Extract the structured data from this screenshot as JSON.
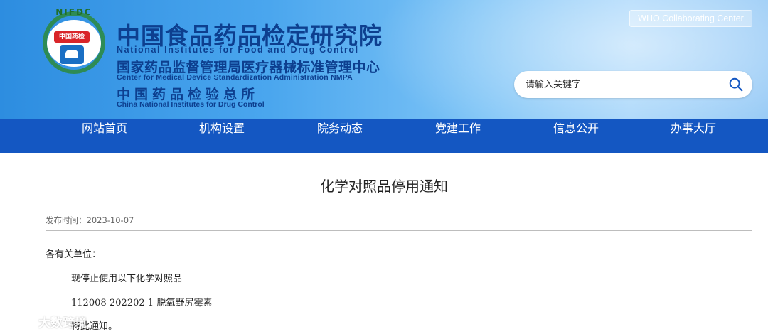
{
  "header": {
    "logo_ring_text": "NIFDC",
    "logo_seal_text": "中国药检",
    "title_cn": "中国食品药品检定研究院",
    "title_en": "National Institutes for Food and Drug Control",
    "sub1_cn": "国家药品监督管理局医疗器械标准管理中心",
    "sub1_en": "Center for Medical Device Standardization Administration NMPA",
    "sub2_cn": "中国药品检验总所",
    "sub2_en": "China National Institutes for Drug Control",
    "who_badge": "WHO Collaborating Center",
    "search": {
      "placeholder": "请输入关键字",
      "value": ""
    }
  },
  "nav": {
    "items": [
      "网站首页",
      "机构设置",
      "院务动态",
      "党建工作",
      "信息公开",
      "办事大厅"
    ]
  },
  "article": {
    "title": "化学对照品停用通知",
    "published_label": "发布时间：",
    "published_date": "2023-10-07",
    "salutation": "各有关单位：",
    "lines": [
      "现停止使用以下化学对照品",
      "112008-202202 1-脱氧野尻霉素",
      "特此通知。"
    ]
  },
  "watermark": {
    "text": "大数跨境"
  },
  "colors": {
    "nav_bg": "#1457c2",
    "title_blue": "#0d3f8f",
    "logo_green": "#2d8a3c",
    "seal_red": "#d9252a"
  }
}
